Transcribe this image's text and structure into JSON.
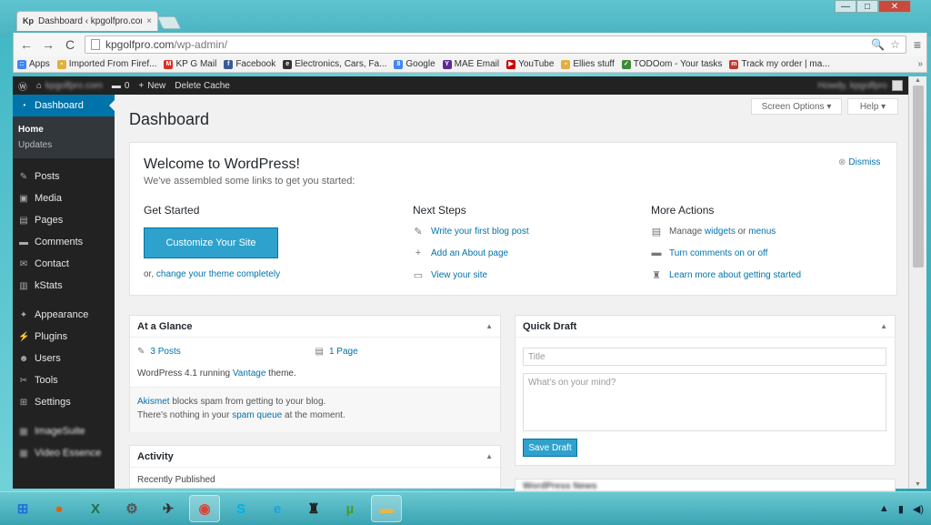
{
  "browser": {
    "tab_title": "Dashboard ‹ kpgolfpro.com",
    "tab_close": "×",
    "url_host": "kpgolfpro.com",
    "url_path": "/wp-admin/",
    "nav_back": "←",
    "nav_forward": "→",
    "nav_reload": "C",
    "zoom_icon": "🔍",
    "star_icon": "☆",
    "menu_icon": "≡",
    "win_min": "—",
    "win_max": "□",
    "win_close": "✕",
    "bookmarks": [
      {
        "label": "Apps",
        "color": "#4285f4",
        "glyph": "::"
      },
      {
        "label": "Imported From Firef...",
        "color": "#e0b040",
        "glyph": "▪"
      },
      {
        "label": "KP G Mail",
        "color": "#d93025",
        "glyph": "M"
      },
      {
        "label": "Facebook",
        "color": "#3b5998",
        "glyph": "f"
      },
      {
        "label": "Electronics, Cars, Fa...",
        "color": "#333333",
        "glyph": "e"
      },
      {
        "label": "Google",
        "color": "#4285f4",
        "glyph": "8"
      },
      {
        "label": "MAE Email",
        "color": "#5b2c91",
        "glyph": "Y"
      },
      {
        "label": "YouTube",
        "color": "#cc0000",
        "glyph": "▶"
      },
      {
        "label": "Ellies stuff",
        "color": "#e0b040",
        "glyph": "▪"
      },
      {
        "label": "TODOom - Your tasks",
        "color": "#3a8a3a",
        "glyph": "✓"
      },
      {
        "label": "Track my order | ma...",
        "color": "#c0392b",
        "glyph": "m"
      }
    ],
    "bookmarks_more": "»"
  },
  "adminbar": {
    "site_name": "kpgolfpro.com",
    "comments_count": "0",
    "new_label": "New",
    "delete_cache": "Delete Cache",
    "howdy": "Howdy, kpgolfpro"
  },
  "sidebar": {
    "dashboard": "Dashboard",
    "submenu": [
      "Home",
      "Updates"
    ],
    "items": [
      {
        "label": "Posts",
        "icon": "✎"
      },
      {
        "label": "Media",
        "icon": "▣"
      },
      {
        "label": "Pages",
        "icon": "▤"
      },
      {
        "label": "Comments",
        "icon": "▬"
      },
      {
        "label": "Contact",
        "icon": "✉"
      },
      {
        "label": "kStats",
        "icon": "▥"
      }
    ],
    "items2": [
      {
        "label": "Appearance",
        "icon": "✦"
      },
      {
        "label": "Plugins",
        "icon": "⚡"
      },
      {
        "label": "Users",
        "icon": "☻"
      },
      {
        "label": "Tools",
        "icon": "✂"
      },
      {
        "label": "Settings",
        "icon": "⊞"
      }
    ],
    "items3": [
      {
        "label": "ImageSuite",
        "icon": "▦"
      },
      {
        "label": "Video Essence",
        "icon": "▦"
      }
    ]
  },
  "main": {
    "title": "Dashboard",
    "screen_options": "Screen Options ▾",
    "help": "Help ▾",
    "welcome": {
      "title": "Welcome to WordPress!",
      "subtitle": "We've assembled some links to get you started:",
      "dismiss": "Dismiss",
      "get_started": "Get Started",
      "customize": "Customize Your Site",
      "or_text": "or, ",
      "change_theme": "change your theme completely",
      "next_steps": "Next Steps",
      "steps": [
        "Write your first blog post",
        "Add an About page",
        "View your site"
      ],
      "more_actions": "More Actions",
      "manage": "Manage ",
      "widgets": "widgets",
      "or": " or ",
      "menus": "menus",
      "turn_comments": "Turn comments on or off",
      "learn_more": "Learn more about getting started"
    },
    "glance": {
      "title": "At a Glance",
      "posts": "3 Posts",
      "pages": "1 Page",
      "running_pre": "WordPress 4.1 running ",
      "theme": "Vantage",
      "running_post": " theme.",
      "akismet": "Akismet",
      "akismet_text": " blocks spam from getting to your blog.",
      "spam_pre": "There's nothing in your ",
      "spam_queue": "spam queue",
      "spam_post": " at the moment."
    },
    "activity": {
      "title": "Activity",
      "recent": "Recently Published"
    },
    "quickdraft": {
      "title": "Quick Draft",
      "title_placeholder": "Title",
      "content_placeholder": "What's on your mind?",
      "save": "Save Draft"
    },
    "news_title": "WordPress News"
  },
  "taskbar": {
    "apps": [
      {
        "name": "start",
        "glyph": "⊞",
        "color": "#1e6fd9"
      },
      {
        "name": "firefox",
        "glyph": "●",
        "color": "#e66000"
      },
      {
        "name": "excel",
        "glyph": "X",
        "color": "#1d7044"
      },
      {
        "name": "network",
        "glyph": "⚙",
        "color": "#555555"
      },
      {
        "name": "bird",
        "glyph": "✈",
        "color": "#333333"
      },
      {
        "name": "chrome",
        "glyph": "◉",
        "color": "#db4437"
      },
      {
        "name": "skype",
        "glyph": "S",
        "color": "#00aff0"
      },
      {
        "name": "ie",
        "glyph": "e",
        "color": "#1ba1e2"
      },
      {
        "name": "graduation",
        "glyph": "♜",
        "color": "#222222"
      },
      {
        "name": "utorrent",
        "glyph": "µ",
        "color": "#4a9a2a"
      },
      {
        "name": "folder",
        "glyph": "▬",
        "color": "#e6b84a"
      }
    ],
    "tray": [
      "▲",
      "▮",
      "◀)"
    ]
  }
}
